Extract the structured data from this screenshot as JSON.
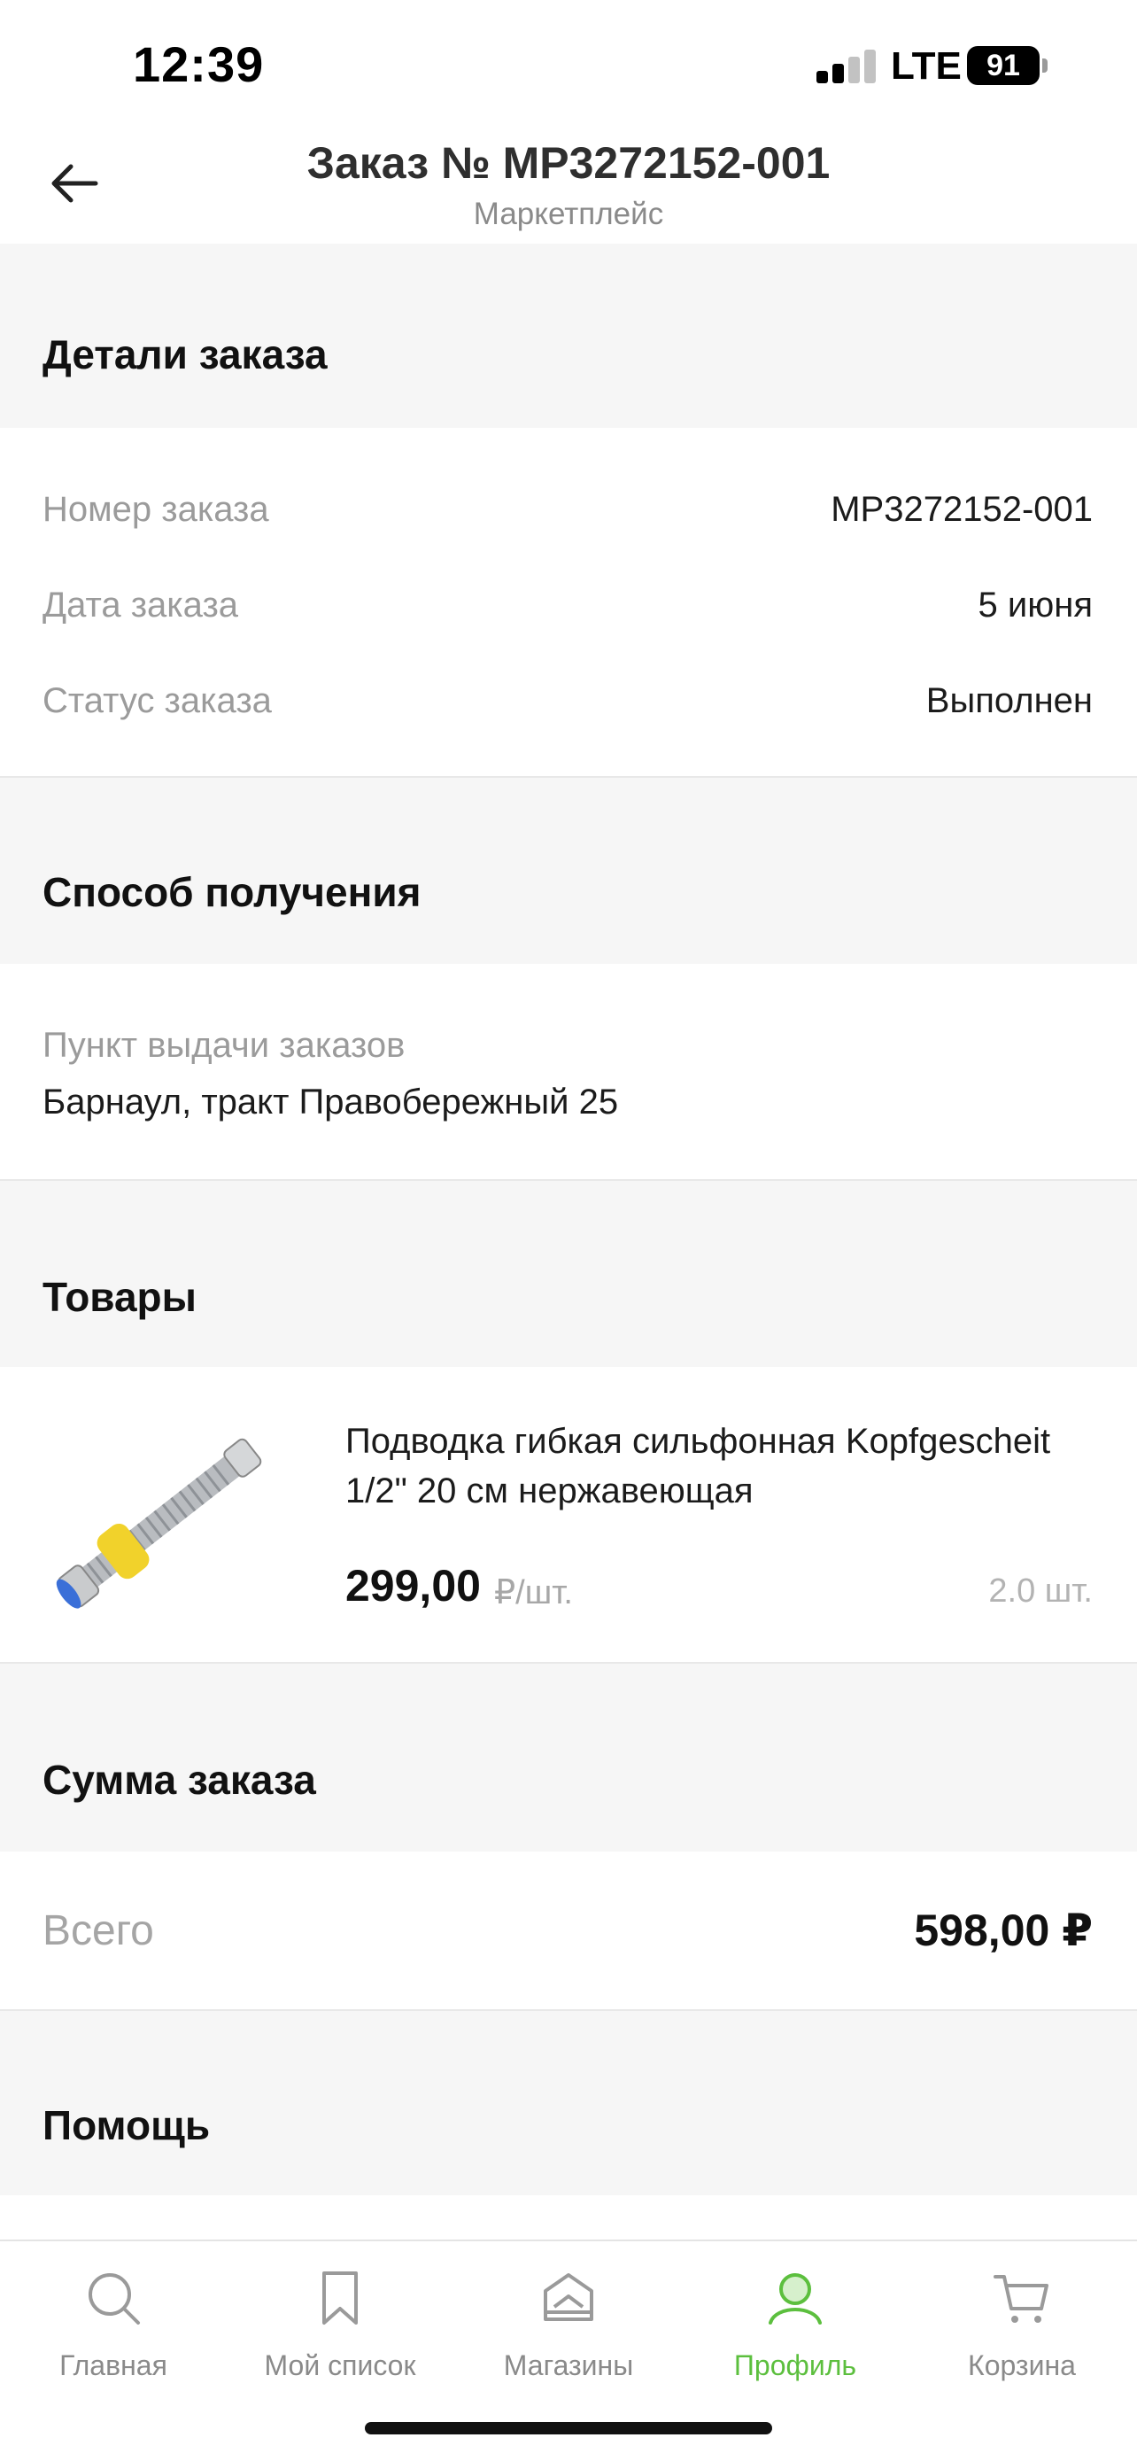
{
  "status_bar": {
    "time": "12:39",
    "network": "LTE",
    "battery": "91"
  },
  "header": {
    "title": "Заказ № МР3272152-001",
    "subtitle": "Маркетплейс"
  },
  "order_details": {
    "title": "Детали заказа",
    "rows": [
      {
        "label": "Номер заказа",
        "value": "МР3272152-001"
      },
      {
        "label": "Дата заказа",
        "value": "5 июня"
      },
      {
        "label": "Статус заказа",
        "value": "Выполнен"
      }
    ]
  },
  "delivery": {
    "title": "Способ получения",
    "label": "Пункт выдачи заказов",
    "address": "Барнаул, тракт Правобережный 25"
  },
  "products": {
    "title": "Товары",
    "items": [
      {
        "name": "Подводка гибкая сильфонная Kopfgescheit 1/2\" 20 см нержавеющая",
        "price": "299,00",
        "unit": "₽/шт.",
        "quantity": "2.0 шт."
      }
    ]
  },
  "summary": {
    "title": "Сумма заказа",
    "label": "Всего",
    "value": "598,00 ₽"
  },
  "help": {
    "title": "Помощь"
  },
  "tabbar": {
    "active_color": "#5cbf3e",
    "tabs": [
      {
        "label": "Главная",
        "icon": "search-icon"
      },
      {
        "label": "Мой список",
        "icon": "bookmark-icon"
      },
      {
        "label": "Магазины",
        "icon": "store-icon"
      },
      {
        "label": "Профиль",
        "icon": "profile-icon",
        "active": true
      },
      {
        "label": "Корзина",
        "icon": "cart-icon"
      }
    ]
  }
}
